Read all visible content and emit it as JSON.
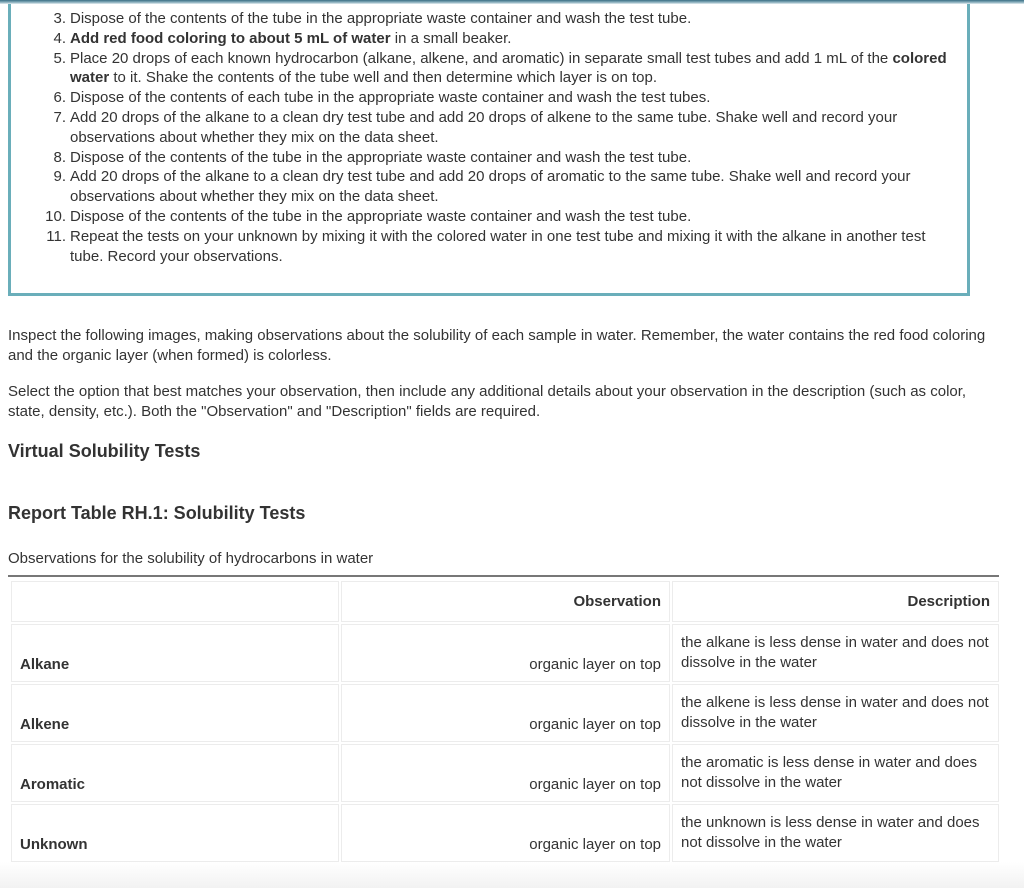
{
  "procedure": {
    "steps": [
      {
        "num": "3.",
        "parts": [
          {
            "text": "Dispose of the contents of the tube in the appropriate waste container and wash the test tube.",
            "bold": false
          }
        ]
      },
      {
        "num": "4.",
        "parts": [
          {
            "text": "Add red food coloring to about 5 mL of water",
            "bold": true
          },
          {
            "text": " in a small beaker.",
            "bold": false
          }
        ]
      },
      {
        "num": "5.",
        "parts": [
          {
            "text": "Place 20 drops of each known hydrocarbon (alkane, alkene, and aromatic) in separate small test tubes and add 1 mL of the ",
            "bold": false
          },
          {
            "text": "colored water",
            "bold": true
          },
          {
            "text": " to it. Shake the contents of the tube well and then determine which layer is on top.",
            "bold": false
          }
        ]
      },
      {
        "num": "6.",
        "parts": [
          {
            "text": "Dispose of the contents of each tube in the appropriate waste container and wash the test tubes.",
            "bold": false
          }
        ]
      },
      {
        "num": "7.",
        "parts": [
          {
            "text": "Add 20 drops of the alkane to a clean dry test tube and add 20 drops of alkene to the same tube. Shake well and record your observations about whether they mix on the data sheet.",
            "bold": false
          }
        ]
      },
      {
        "num": "8.",
        "parts": [
          {
            "text": "Dispose of the contents of the tube in the appropriate waste container and wash the test tube.",
            "bold": false
          }
        ]
      },
      {
        "num": "9.",
        "parts": [
          {
            "text": "Add 20 drops of the alkane to a clean dry test tube and add 20 drops of aromatic to the same tube. Shake well and record your observations about whether they mix on the data sheet.",
            "bold": false
          }
        ]
      },
      {
        "num": "10.",
        "parts": [
          {
            "text": "Dispose of the contents of the tube in the appropriate waste container and wash the test tube.",
            "bold": false
          }
        ]
      },
      {
        "num": "11.",
        "parts": [
          {
            "text": "Repeat the tests on your unknown by mixing it with the colored water in one test tube and mixing it with the alkane in another test tube. Record your observations.",
            "bold": false
          }
        ]
      }
    ]
  },
  "instructions": {
    "inspect": "Inspect the following images, making observations about the solubility of each sample in water. Remember, the water contains the red food coloring and the organic layer (when formed) is colorless.",
    "select": "Select the option that best matches your observation, then include any additional details about your observation in the description (such as color, state, density, etc.). Both the \"Observation\" and \"Description\" fields are required."
  },
  "headings": {
    "virtual_tests": "Virtual Solubility Tests",
    "report_table": "Report Table RH.1: Solubility Tests"
  },
  "table": {
    "caption": "Observations for the solubility of hydrocarbons in water",
    "headers": [
      "",
      "Observation",
      "Description"
    ],
    "rows": [
      {
        "name": "Alkane",
        "observation": "organic layer on top",
        "description": "the alkane is less dense in water and does not dissolve in the water"
      },
      {
        "name": "Alkene",
        "observation": "organic layer on top",
        "description": "the alkene is less dense in water and does not dissolve in the water"
      },
      {
        "name": "Aromatic",
        "observation": "organic layer on top",
        "description": "the aromatic is less dense in water and does not dissolve in the water"
      },
      {
        "name": "Unknown",
        "observation": "organic layer on top",
        "description": "the unknown is less dense in water and does not dissolve in the water"
      }
    ]
  },
  "colors": {
    "box_border": "#6aaeba",
    "text": "#333333"
  }
}
